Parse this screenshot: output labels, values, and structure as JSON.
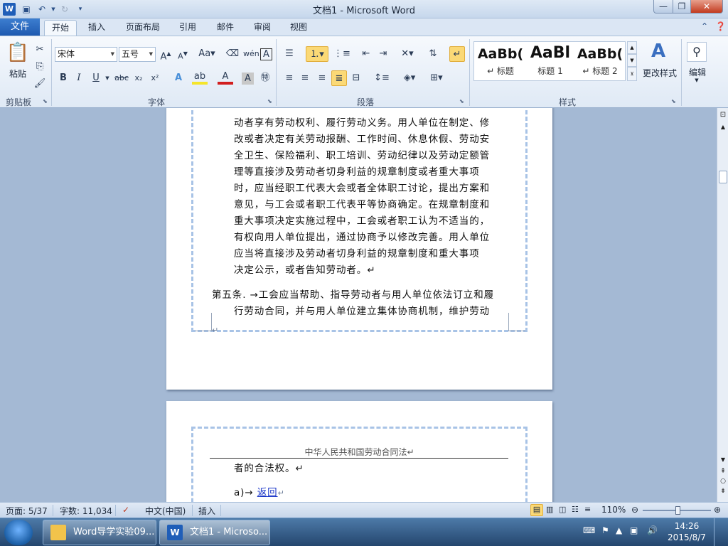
{
  "window": {
    "title": "文档1 - Microsoft Word",
    "app_icon": "W",
    "minimize_glyph": "—",
    "maximize_glyph": "❐",
    "close_glyph": "✕"
  },
  "tabs": {
    "file": "文件",
    "items": [
      "开始",
      "插入",
      "页面布局",
      "引用",
      "邮件",
      "审阅",
      "视图"
    ],
    "active_index": 0
  },
  "ribbon": {
    "clipboard": {
      "label": "剪贴板",
      "paste": "粘贴"
    },
    "font": {
      "label": "字体",
      "font_name": "宋体",
      "font_size": "五号"
    },
    "paragraph": {
      "label": "段落"
    },
    "styles": {
      "label": "样式",
      "items": [
        {
          "sample": "AaBb(",
          "name": "↵ 标题"
        },
        {
          "sample": "AaBl",
          "name": "标题 1"
        },
        {
          "sample": "AaBb(",
          "name": "↵ 标题 2"
        }
      ],
      "change_styles": "更改样式"
    },
    "editing": {
      "label": "编辑"
    }
  },
  "document": {
    "page1_lines": [
      "动者享有劳动权利、履行劳动义务。用人单位在制定、修",
      "改或者决定有关劳动报酬、工作时间、休息休假、劳动安",
      "全卫生、保险福利、职工培训、劳动纪律以及劳动定额管",
      "理等直接涉及劳动者切身利益的规章制度或者重大事项",
      "时，应当经职工代表大会或者全体职工讨论，提出方案和",
      "意见，与工会或者职工代表平等协商确定。在规章制度和",
      "重大事项决定实施过程中，工会或者职工认为不适当的，",
      "有权向用人单位提出，通过协商予以修改完善。用人单位",
      "应当将直接涉及劳动者切身利益的规章制度和重大事项",
      "决定公示，或者告知劳动者。↵"
    ],
    "article5_prefix": "第五条. →",
    "article5_line1": "工会应当帮助、指导劳动者与用人单位依法订立和履",
    "article5_line2": "行劳动合同，并与用人单位建立集体协商机制，维护劳动",
    "empty_para": "↵",
    "page2_header": "中华人民共和国劳动合同法↵",
    "page2_line1": "者的合法权。↵",
    "page2_item_prefix": "a)→ ",
    "page2_link": "返回",
    "page2_link_mark": "↵"
  },
  "statusbar": {
    "page": "页面: 5/37",
    "words": "字数: 11,034",
    "language": "中文(中国)",
    "mode": "插入",
    "zoom": "110%",
    "zoom_level_percent": 110
  },
  "taskbar": {
    "items": [
      "Word导学实验09...",
      "文档1 - Microso..."
    ],
    "time": "14:26",
    "date": "2015/8/7"
  },
  "colors": {
    "accent_blue": "#1f5eb8",
    "highlight": "#fbd976",
    "link": "#1a36c8"
  }
}
